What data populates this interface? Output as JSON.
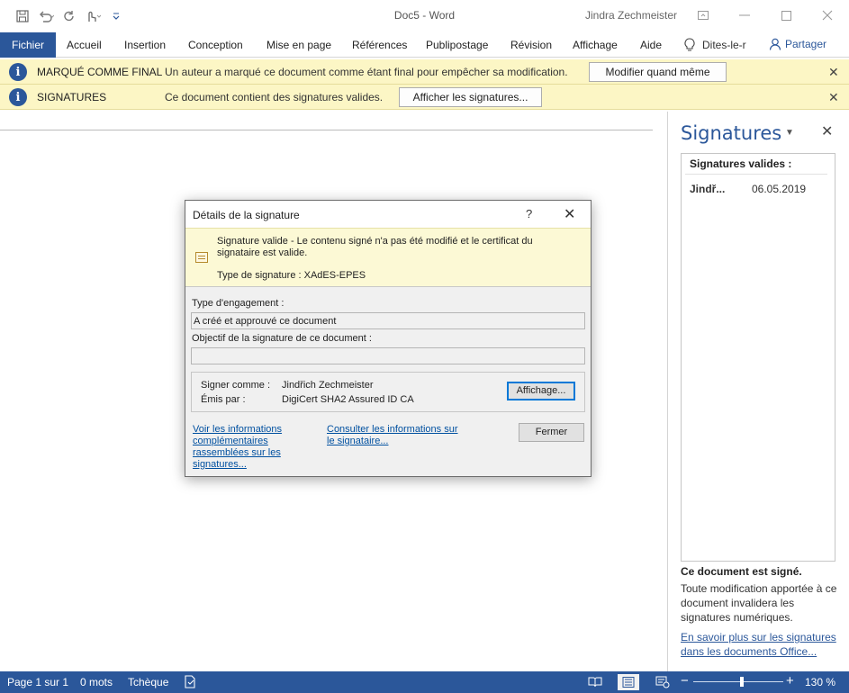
{
  "window": {
    "title": "Doc5 - Word",
    "user": "Jindra Zechmeister"
  },
  "ribbon": {
    "tabs": [
      {
        "label": "Fichier"
      },
      {
        "label": "Accueil"
      },
      {
        "label": "Insertion"
      },
      {
        "label": "Conception"
      },
      {
        "label": "Mise en page"
      },
      {
        "label": "Références"
      },
      {
        "label": "Publipostage"
      },
      {
        "label": "Révision"
      },
      {
        "label": "Affichage"
      },
      {
        "label": "Aide"
      }
    ],
    "tell_me": "Dites-le-r",
    "share": "Partager"
  },
  "message_bars": [
    {
      "title": "MARQUÉ COMME FINAL",
      "text": "Un auteur a marqué ce document comme étant final pour empêcher sa modification.",
      "button": "Modifier quand même"
    },
    {
      "title": "SIGNATURES",
      "text": "Ce document contient des signatures valides.",
      "button": "Afficher les signatures..."
    }
  ],
  "pane": {
    "title": "Signatures",
    "list_header": "Signatures valides :",
    "signatures": [
      {
        "name": "Jindř...",
        "date": "06.05.2019"
      }
    ],
    "signed_title": "Ce document est signé.",
    "signed_text": "Toute modification apportée à ce document invalidera les signatures numériques.",
    "learn_more": "En savoir plus sur les signatures dans les documents Office..."
  },
  "dialog": {
    "title": "Détails de la signature",
    "help": "?",
    "valid_text": "Signature valide - Le contenu signé n'a pas été modifié et le certificat du signataire est valide.",
    "signature_type": "Type de signature : XAdES-EPES",
    "commitment_label": "Type d'engagement :",
    "commitment_value": "A créé et approuvé ce document",
    "purpose_label": "Objectif de la signature de ce document :",
    "purpose_value": "",
    "signer_label": "Signer comme :",
    "signer_value": "Jindřich Zechmeister",
    "issuer_label": "Émis par :",
    "issuer_value": "DigiCert SHA2 Assured ID CA",
    "view_button": "Affichage...",
    "more_info_link": "Voir les informations complémentaires rassemblées sur les signatures...",
    "signer_info_link": "Consulter les informations sur le signataire...",
    "close_button": "Fermer"
  },
  "status": {
    "page": "Page 1 sur 1",
    "words": "0 mots",
    "language": "Tchèque",
    "zoom_level": 130,
    "zoom": "130 %"
  },
  "colors": {
    "accent": "#2b579a",
    "message_bar": "#fcf6c5",
    "dialog_banner": "#fcf9d5"
  }
}
